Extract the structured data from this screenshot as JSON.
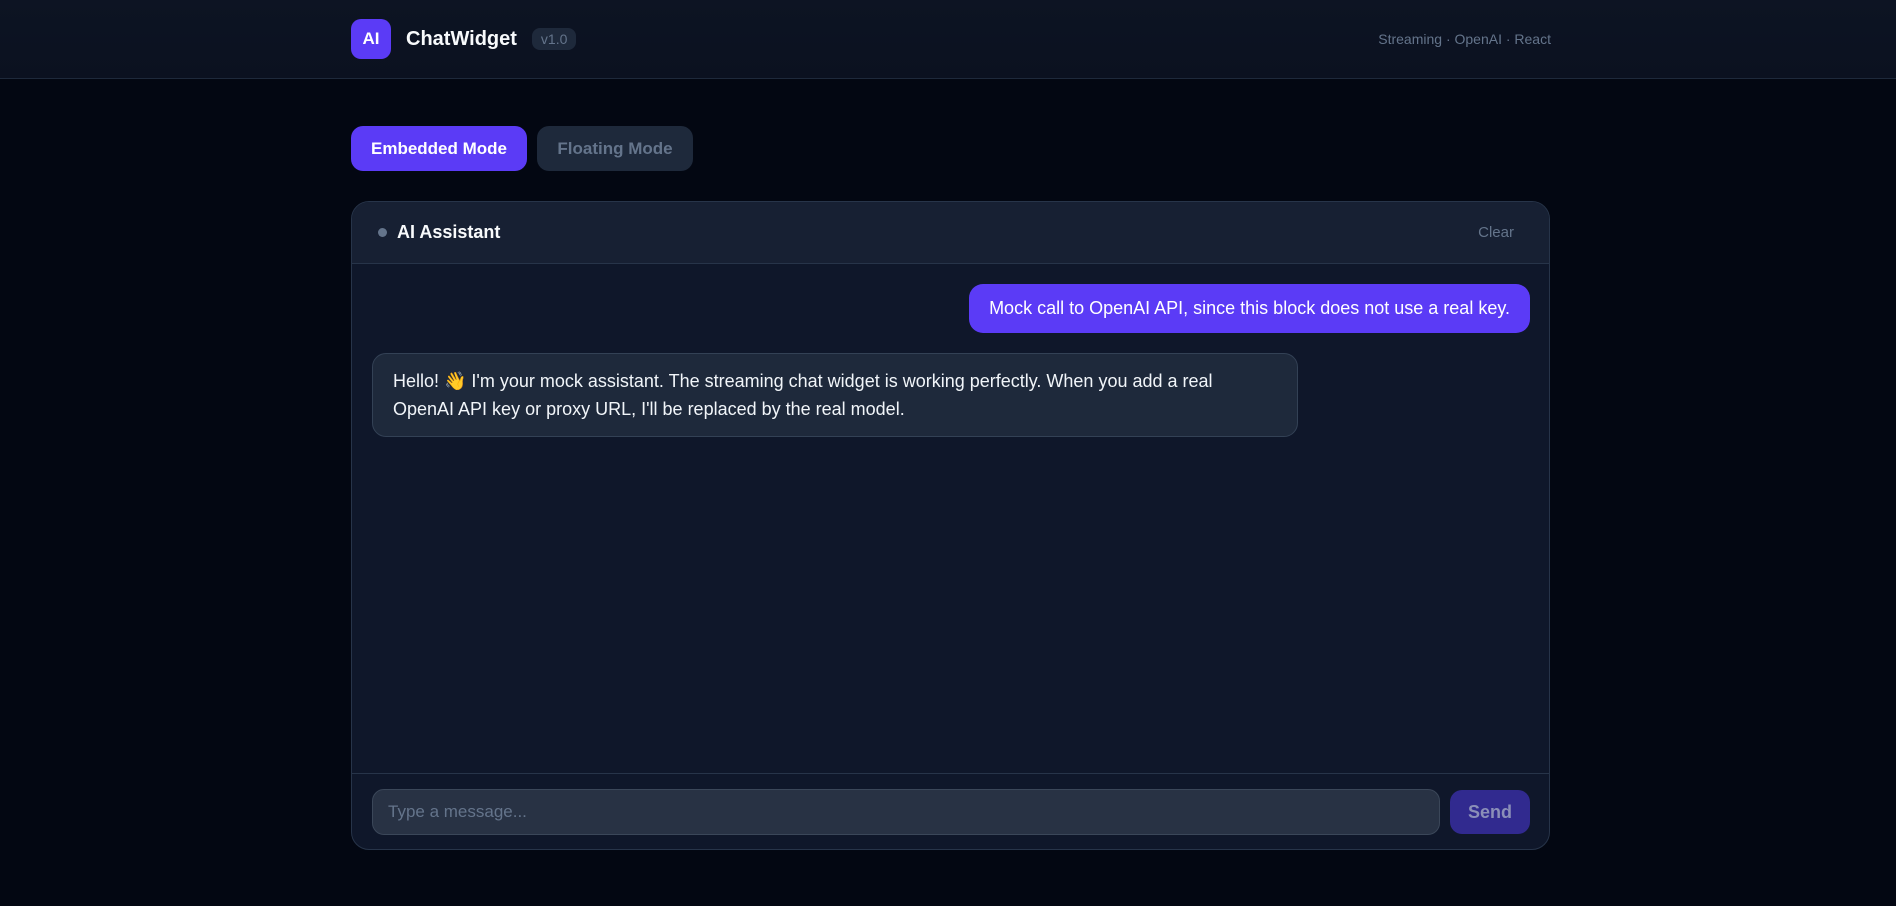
{
  "header": {
    "logo_text": "AI",
    "app_title": "ChatWidget",
    "version": "v1.0",
    "tagline": "Streaming · OpenAI · React"
  },
  "modes": {
    "embedded_label": "Embedded Mode",
    "floating_label": "Floating Mode",
    "selected": "Embedded Mode"
  },
  "chat": {
    "title": "AI Assistant",
    "clear_label": "Clear",
    "messages": [
      {
        "role": "user",
        "text": "Mock call to OpenAI API, since this block does not use a real key."
      },
      {
        "role": "assistant",
        "text": "Hello! 👋 I'm your mock assistant. The streaming chat widget is working perfectly. When you add a real OpenAI API key or proxy URL, I'll be replaced by the real model."
      }
    ],
    "input_value": "",
    "input_placeholder": "Type a message...",
    "send_label": "Send"
  },
  "colors": {
    "accent": "#5b3bf6",
    "background": "#030712",
    "panel": "#0f172a",
    "muted_text": "#64748b"
  }
}
